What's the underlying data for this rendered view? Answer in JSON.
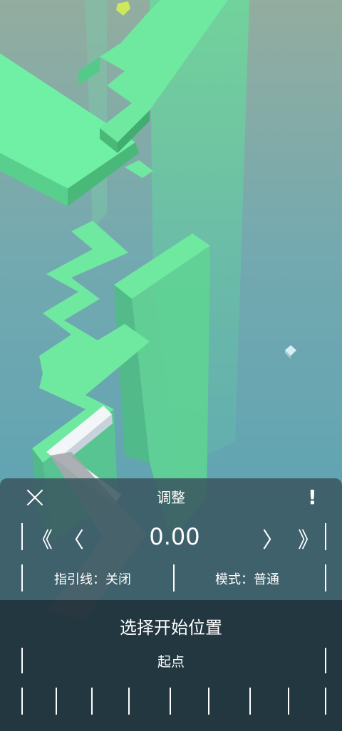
{
  "panel": {
    "title": "调整",
    "info_symbol": "!",
    "fast_back": "《",
    "step_back": "〈",
    "offset_value": "0.00",
    "step_forward": "〉",
    "fast_forward": "》",
    "guide_line_label": "指引线：关闭",
    "mode_label": "模式：普通"
  },
  "start_panel": {
    "title": "选择开始位置",
    "start_label": "起点"
  },
  "colors": {
    "sky_top": "#8fb0a8",
    "sky_bottom": "#5aa6b8",
    "path_green": "#6fe8a0",
    "wall_green": "#5ccf88",
    "white_line": "#f2f6f8"
  }
}
